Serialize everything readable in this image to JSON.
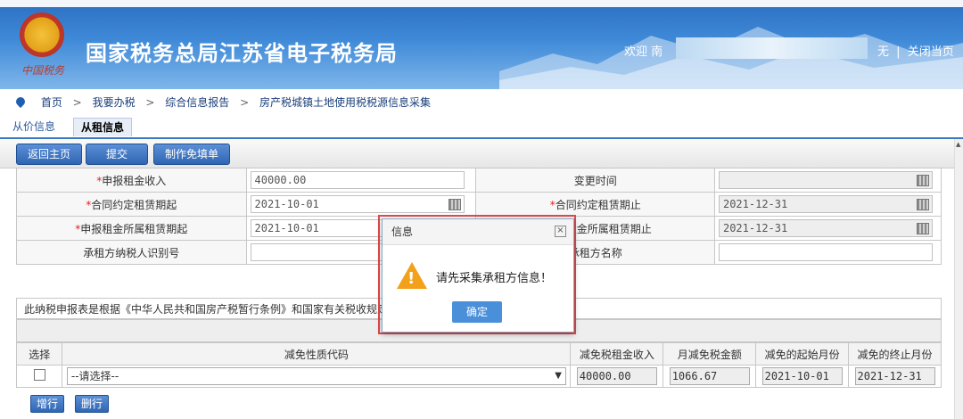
{
  "header": {
    "emblem_text": "中国税务",
    "site_title": "国家税务总局江苏省电子税务局",
    "welcome": "欢迎 南",
    "links": [
      "无",
      "关闭当页"
    ],
    "link_sep": "|"
  },
  "breadcrumb": {
    "items": [
      "首页",
      "我要办税",
      "综合信息报告",
      "房产税城镇土地使用税税源信息采集"
    ],
    "sep": ">"
  },
  "tabs": [
    "从价信息",
    "从租信息"
  ],
  "toolbar": {
    "buttons": [
      "返回主页",
      "提交",
      "制作免填单"
    ]
  },
  "form": {
    "rows": [
      {
        "l1": "申报租金收入",
        "v1": "40000.00",
        "l2": "变更时间",
        "v2": "",
        "req1": true,
        "req2": false,
        "cal1": false,
        "cal2": true
      },
      {
        "l1": "合同约定租赁期起",
        "v1": "2021-10-01",
        "l2": "合同约定租赁期止",
        "v2": "2021-12-31",
        "req1": true,
        "req2": true,
        "cal1": true,
        "cal2": true
      },
      {
        "l1": "申报租金所属租赁期起",
        "v1": "2021-10-01",
        "l2": "申报租金所属租赁期止",
        "v2": "2021-12-31",
        "req1": true,
        "req2": true,
        "cal1": false,
        "cal2": true
      },
      {
        "l1": "承租方纳税人识别号",
        "v1": "",
        "l2": "承租方名称",
        "v2": "",
        "req1": false,
        "req2": false,
        "cal1": false,
        "cal2": false
      }
    ],
    "req_mark": "*"
  },
  "note": "此纳税申报表是根据《中华人民共和国房产税暂行条例》和国家有关税收规定填报的，",
  "relief_table": {
    "headers": [
      "选择",
      "减免性质代码",
      "减免税租金收入",
      "月减免税金额",
      "减免的起始月份",
      "减免的终止月份"
    ],
    "row": {
      "select_placeholder": "--请选择--",
      "income": "40000.00",
      "monthly": "1066.67",
      "start": "2021-10-01",
      "end": "2021-12-31"
    }
  },
  "row_buttons": [
    "增行",
    "删行"
  ],
  "dialog": {
    "title": "信息",
    "message": "请先采集承租方信息！",
    "ok": "确定",
    "icon": "warning-icon"
  }
}
